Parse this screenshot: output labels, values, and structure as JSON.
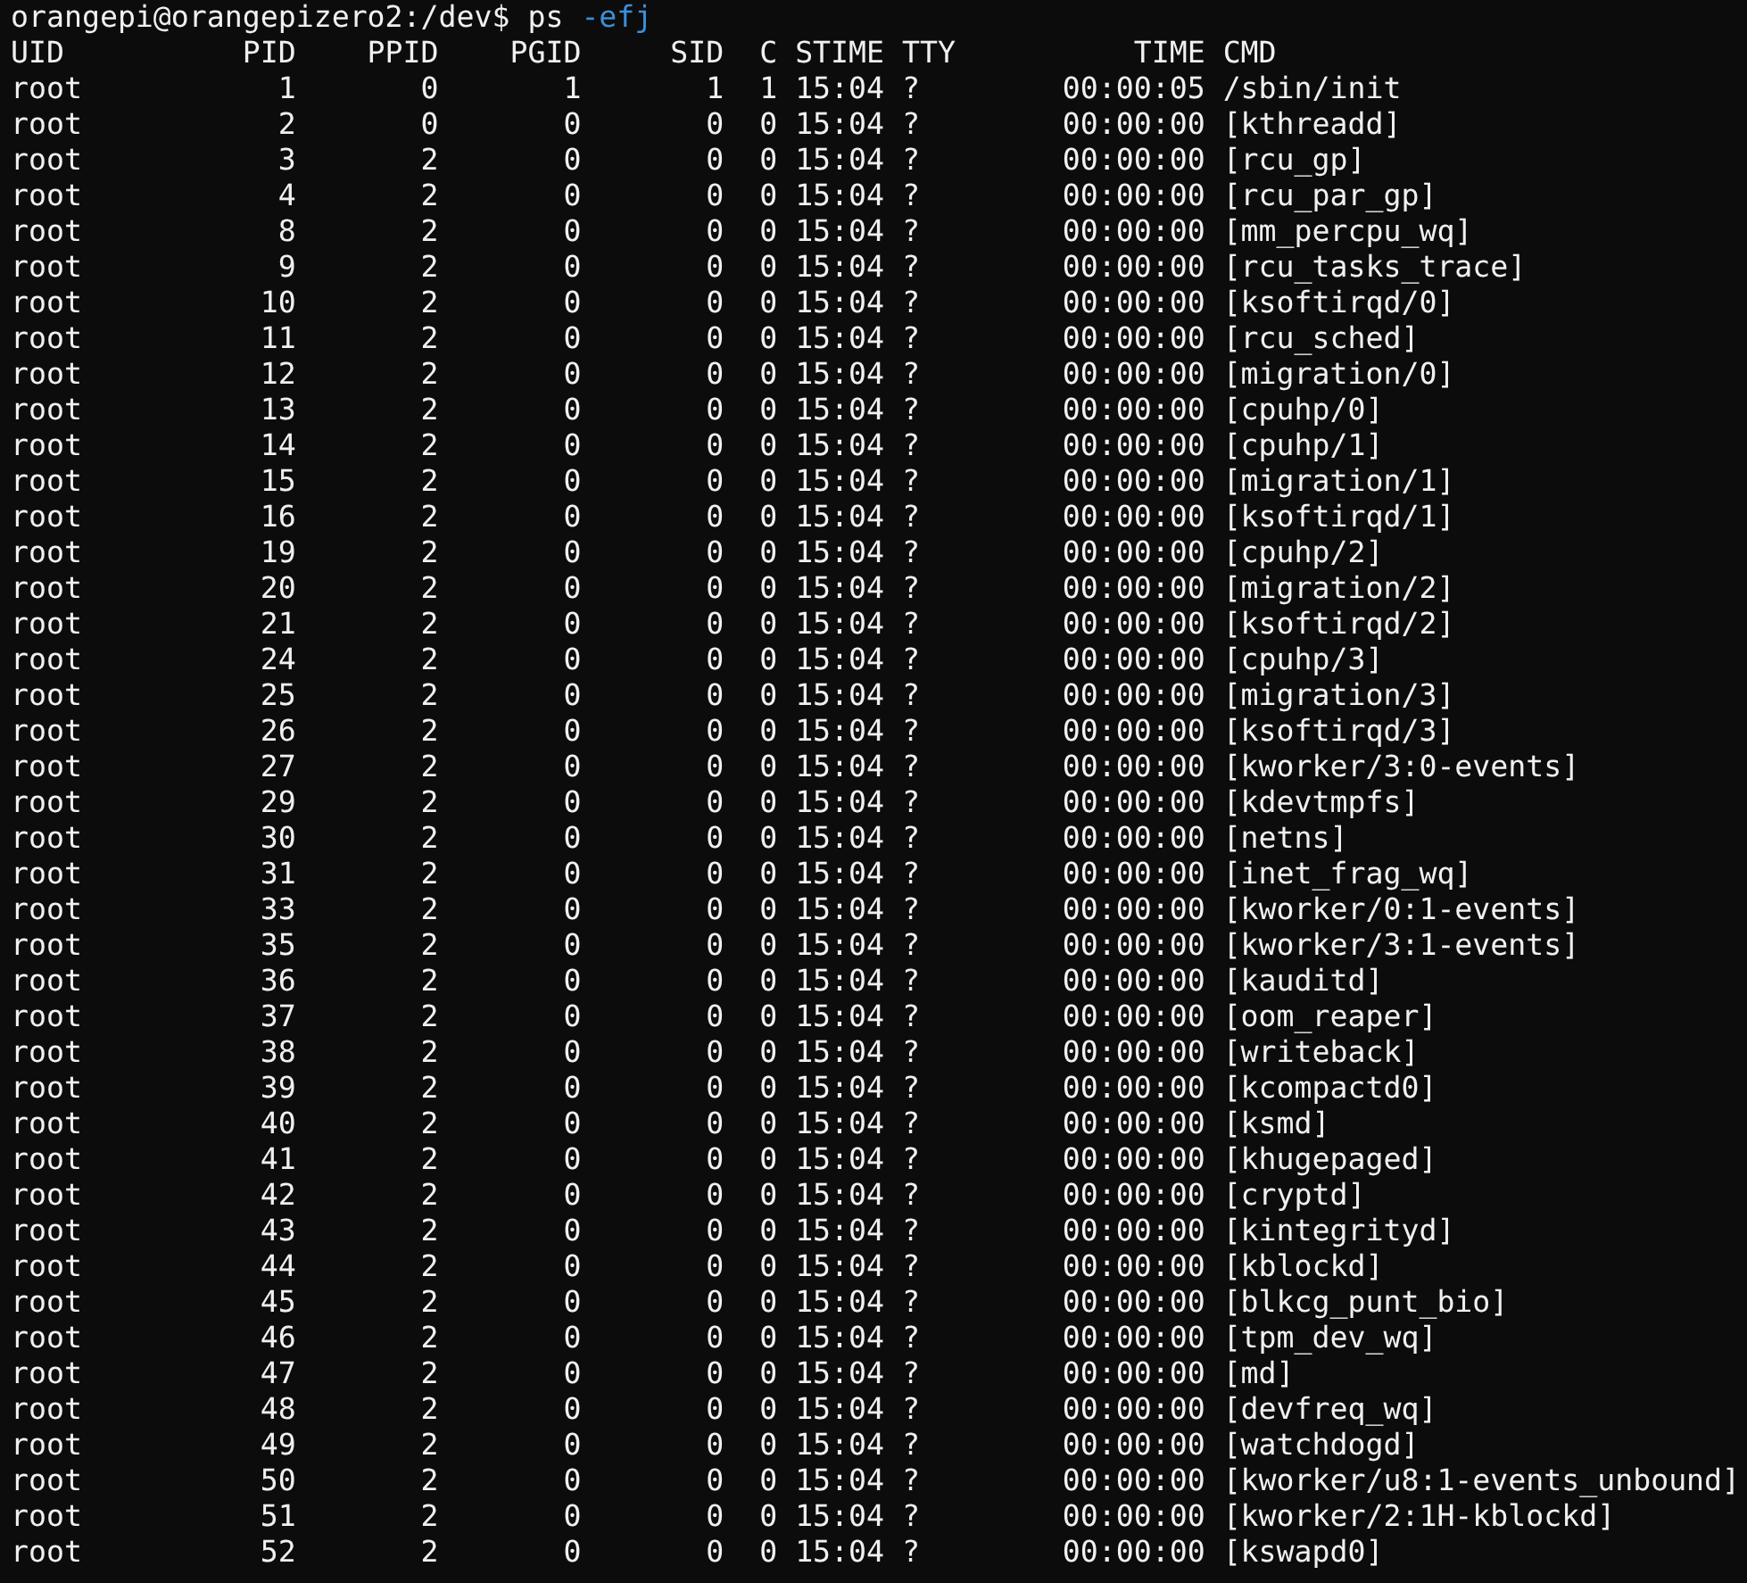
{
  "prompt": {
    "user_host": "orangepi@orangepizero2:/dev$",
    "command": "ps",
    "options": "-efj"
  },
  "columns": [
    "UID",
    "PID",
    "PPID",
    "PGID",
    "SID",
    "C",
    "STIME",
    "TTY",
    "TIME",
    "CMD"
  ],
  "rows": [
    [
      "root",
      "1",
      "0",
      "1",
      "1",
      "1",
      "15:04",
      "?",
      "00:00:05",
      "/sbin/init"
    ],
    [
      "root",
      "2",
      "0",
      "0",
      "0",
      "0",
      "15:04",
      "?",
      "00:00:00",
      "[kthreadd]"
    ],
    [
      "root",
      "3",
      "2",
      "0",
      "0",
      "0",
      "15:04",
      "?",
      "00:00:00",
      "[rcu_gp]"
    ],
    [
      "root",
      "4",
      "2",
      "0",
      "0",
      "0",
      "15:04",
      "?",
      "00:00:00",
      "[rcu_par_gp]"
    ],
    [
      "root",
      "8",
      "2",
      "0",
      "0",
      "0",
      "15:04",
      "?",
      "00:00:00",
      "[mm_percpu_wq]"
    ],
    [
      "root",
      "9",
      "2",
      "0",
      "0",
      "0",
      "15:04",
      "?",
      "00:00:00",
      "[rcu_tasks_trace]"
    ],
    [
      "root",
      "10",
      "2",
      "0",
      "0",
      "0",
      "15:04",
      "?",
      "00:00:00",
      "[ksoftirqd/0]"
    ],
    [
      "root",
      "11",
      "2",
      "0",
      "0",
      "0",
      "15:04",
      "?",
      "00:00:00",
      "[rcu_sched]"
    ],
    [
      "root",
      "12",
      "2",
      "0",
      "0",
      "0",
      "15:04",
      "?",
      "00:00:00",
      "[migration/0]"
    ],
    [
      "root",
      "13",
      "2",
      "0",
      "0",
      "0",
      "15:04",
      "?",
      "00:00:00",
      "[cpuhp/0]"
    ],
    [
      "root",
      "14",
      "2",
      "0",
      "0",
      "0",
      "15:04",
      "?",
      "00:00:00",
      "[cpuhp/1]"
    ],
    [
      "root",
      "15",
      "2",
      "0",
      "0",
      "0",
      "15:04",
      "?",
      "00:00:00",
      "[migration/1]"
    ],
    [
      "root",
      "16",
      "2",
      "0",
      "0",
      "0",
      "15:04",
      "?",
      "00:00:00",
      "[ksoftirqd/1]"
    ],
    [
      "root",
      "19",
      "2",
      "0",
      "0",
      "0",
      "15:04",
      "?",
      "00:00:00",
      "[cpuhp/2]"
    ],
    [
      "root",
      "20",
      "2",
      "0",
      "0",
      "0",
      "15:04",
      "?",
      "00:00:00",
      "[migration/2]"
    ],
    [
      "root",
      "21",
      "2",
      "0",
      "0",
      "0",
      "15:04",
      "?",
      "00:00:00",
      "[ksoftirqd/2]"
    ],
    [
      "root",
      "24",
      "2",
      "0",
      "0",
      "0",
      "15:04",
      "?",
      "00:00:00",
      "[cpuhp/3]"
    ],
    [
      "root",
      "25",
      "2",
      "0",
      "0",
      "0",
      "15:04",
      "?",
      "00:00:00",
      "[migration/3]"
    ],
    [
      "root",
      "26",
      "2",
      "0",
      "0",
      "0",
      "15:04",
      "?",
      "00:00:00",
      "[ksoftirqd/3]"
    ],
    [
      "root",
      "27",
      "2",
      "0",
      "0",
      "0",
      "15:04",
      "?",
      "00:00:00",
      "[kworker/3:0-events]"
    ],
    [
      "root",
      "29",
      "2",
      "0",
      "0",
      "0",
      "15:04",
      "?",
      "00:00:00",
      "[kdevtmpfs]"
    ],
    [
      "root",
      "30",
      "2",
      "0",
      "0",
      "0",
      "15:04",
      "?",
      "00:00:00",
      "[netns]"
    ],
    [
      "root",
      "31",
      "2",
      "0",
      "0",
      "0",
      "15:04",
      "?",
      "00:00:00",
      "[inet_frag_wq]"
    ],
    [
      "root",
      "33",
      "2",
      "0",
      "0",
      "0",
      "15:04",
      "?",
      "00:00:00",
      "[kworker/0:1-events]"
    ],
    [
      "root",
      "35",
      "2",
      "0",
      "0",
      "0",
      "15:04",
      "?",
      "00:00:00",
      "[kworker/3:1-events]"
    ],
    [
      "root",
      "36",
      "2",
      "0",
      "0",
      "0",
      "15:04",
      "?",
      "00:00:00",
      "[kauditd]"
    ],
    [
      "root",
      "37",
      "2",
      "0",
      "0",
      "0",
      "15:04",
      "?",
      "00:00:00",
      "[oom_reaper]"
    ],
    [
      "root",
      "38",
      "2",
      "0",
      "0",
      "0",
      "15:04",
      "?",
      "00:00:00",
      "[writeback]"
    ],
    [
      "root",
      "39",
      "2",
      "0",
      "0",
      "0",
      "15:04",
      "?",
      "00:00:00",
      "[kcompactd0]"
    ],
    [
      "root",
      "40",
      "2",
      "0",
      "0",
      "0",
      "15:04",
      "?",
      "00:00:00",
      "[ksmd]"
    ],
    [
      "root",
      "41",
      "2",
      "0",
      "0",
      "0",
      "15:04",
      "?",
      "00:00:00",
      "[khugepaged]"
    ],
    [
      "root",
      "42",
      "2",
      "0",
      "0",
      "0",
      "15:04",
      "?",
      "00:00:00",
      "[cryptd]"
    ],
    [
      "root",
      "43",
      "2",
      "0",
      "0",
      "0",
      "15:04",
      "?",
      "00:00:00",
      "[kintegrityd]"
    ],
    [
      "root",
      "44",
      "2",
      "0",
      "0",
      "0",
      "15:04",
      "?",
      "00:00:00",
      "[kblockd]"
    ],
    [
      "root",
      "45",
      "2",
      "0",
      "0",
      "0",
      "15:04",
      "?",
      "00:00:00",
      "[blkcg_punt_bio]"
    ],
    [
      "root",
      "46",
      "2",
      "0",
      "0",
      "0",
      "15:04",
      "?",
      "00:00:00",
      "[tpm_dev_wq]"
    ],
    [
      "root",
      "47",
      "2",
      "0",
      "0",
      "0",
      "15:04",
      "?",
      "00:00:00",
      "[md]"
    ],
    [
      "root",
      "48",
      "2",
      "0",
      "0",
      "0",
      "15:04",
      "?",
      "00:00:00",
      "[devfreq_wq]"
    ],
    [
      "root",
      "49",
      "2",
      "0",
      "0",
      "0",
      "15:04",
      "?",
      "00:00:00",
      "[watchdogd]"
    ],
    [
      "root",
      "50",
      "2",
      "0",
      "0",
      "0",
      "15:04",
      "?",
      "00:00:00",
      "[kworker/u8:1-events_unbound]"
    ],
    [
      "root",
      "51",
      "2",
      "0",
      "0",
      "0",
      "15:04",
      "?",
      "00:00:00",
      "[kworker/2:1H-kblockd]"
    ],
    [
      "root",
      "52",
      "2",
      "0",
      "0",
      "0",
      "15:04",
      "?",
      "00:00:00",
      "[kswapd0]"
    ]
  ]
}
